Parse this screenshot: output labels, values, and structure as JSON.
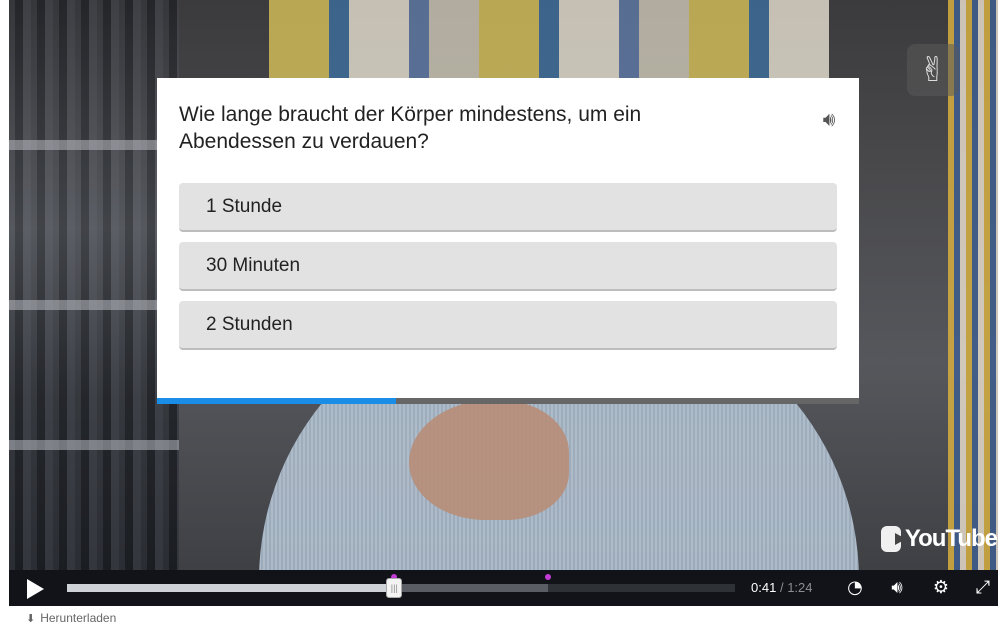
{
  "quiz": {
    "question": "Wie lange braucht der Körper mindestens, um ein Abendessen zu verdauen?",
    "speaker_icon": "speaker-icon",
    "answers": [
      {
        "label": "1 Stunde"
      },
      {
        "label": "30 Minuten"
      },
      {
        "label": "2 Stunden"
      }
    ],
    "progress_fraction": 0.34,
    "progress_color": "#1a8ee6"
  },
  "player": {
    "current_time": "0:41",
    "separator": "/",
    "duration": "1:24",
    "played_fraction": 0.49,
    "buffered_fraction": 0.72,
    "marker_fractions": [
      0.49,
      0.72
    ],
    "marker_color": "#c43bd6",
    "brand": "YouTube",
    "icons": [
      "play-icon",
      "speed-icon",
      "volume-icon",
      "settings-gear-icon",
      "fullscreen-icon"
    ]
  },
  "footer": {
    "download_label": "Herunterladen",
    "download_icon": "download-icon"
  }
}
